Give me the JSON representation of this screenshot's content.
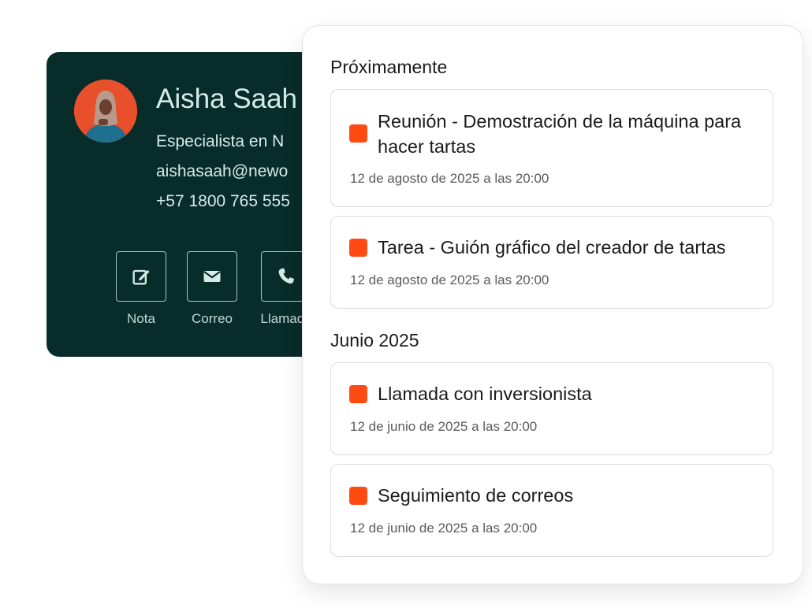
{
  "contact": {
    "name": "Aisha Saah",
    "title": "Especialista en N",
    "email": "aishasaah@newo",
    "phone": "+57 1800 765 555",
    "actions": [
      {
        "label": "Nota",
        "icon": "edit-icon"
      },
      {
        "label": "Correo",
        "icon": "mail-icon"
      },
      {
        "label": "Llamada",
        "icon": "phone-icon"
      }
    ]
  },
  "activity": {
    "sections": [
      {
        "heading": "Próximamente",
        "items": [
          {
            "title": "Reunión - Demostración de la máquina para hacer tartas",
            "date": "12 de agosto de 2025 a las 20:00"
          },
          {
            "title": "Tarea - Guión gráfico del creador de tartas",
            "date": "12 de agosto de 2025 a las 20:00"
          }
        ]
      },
      {
        "heading": "Junio 2025",
        "items": [
          {
            "title": "Llamada con inversionista",
            "date": "12 de junio de 2025 a las 20:00"
          },
          {
            "title": "Seguimiento de correos",
            "date": "12 de junio de 2025 a las 20:00"
          }
        ]
      }
    ]
  },
  "colors": {
    "card_background": "#082c2a",
    "accent": "#ff4b12",
    "avatar_background": "#e8502b"
  }
}
